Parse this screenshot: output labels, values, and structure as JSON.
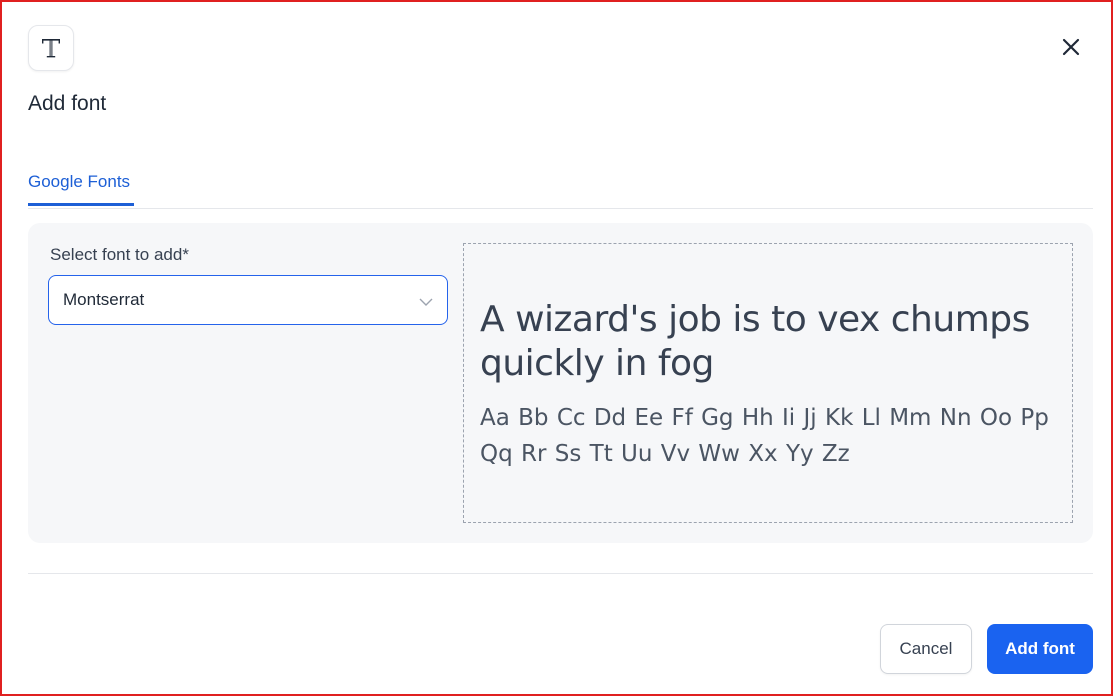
{
  "dialog": {
    "title": "Add font",
    "logo_icon": "text-font-icon",
    "close_icon": "close-icon"
  },
  "tabs": [
    {
      "label": "Google Fonts",
      "active": true
    }
  ],
  "form": {
    "select_label": "Select font to add*",
    "selected_font": "Montserrat",
    "dropdown_icon": "chevron-down-icon"
  },
  "preview": {
    "sentence": "A wizard's job is to vex chumps quickly in fog",
    "alphabet": "Aa Bb Cc Dd Ee Ff Gg Hh Ii Jj Kk Ll Mm Nn Oo Pp Qq Rr Ss Tt Uu Vv Ww Xx Yy Zz"
  },
  "footer": {
    "cancel_label": "Cancel",
    "submit_label": "Add font"
  },
  "colors": {
    "accent": "#1a63f0",
    "frame_border": "#e02020",
    "panel_bg": "#f6f7f9"
  }
}
